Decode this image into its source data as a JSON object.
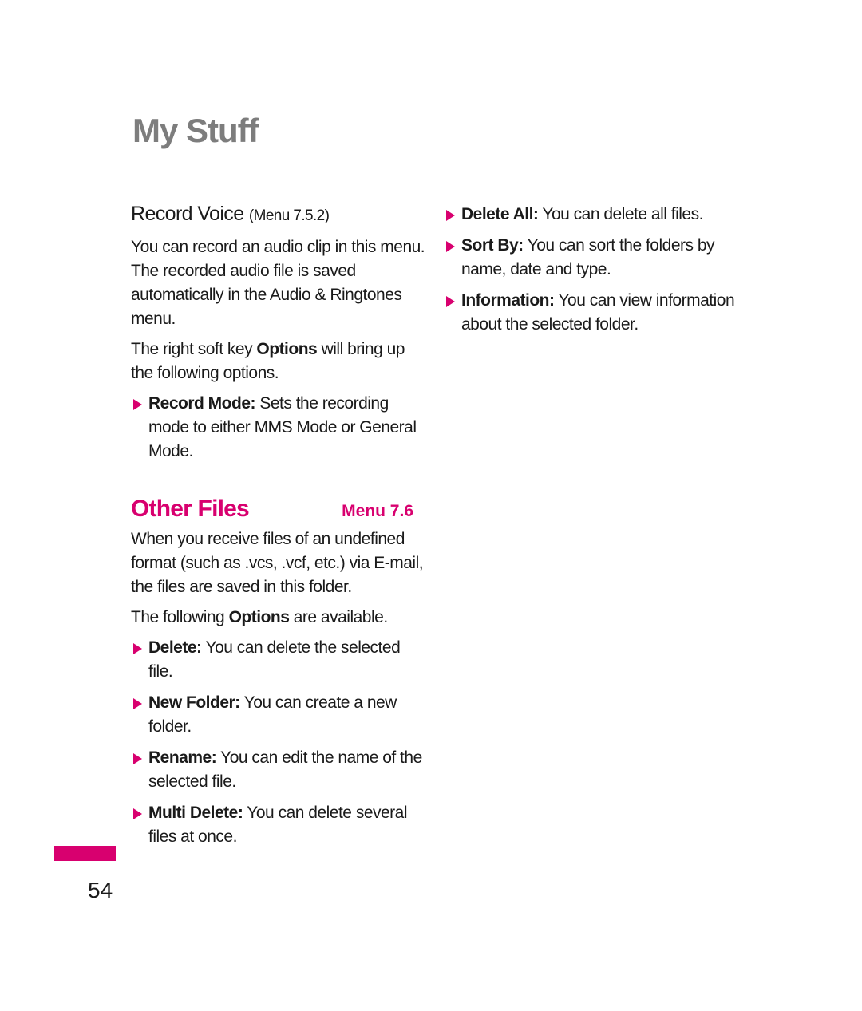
{
  "page": {
    "title": "My Stuff",
    "page_number": "54",
    "accent_color": "#d8006f"
  },
  "record_voice": {
    "heading": "Record Voice",
    "menu_ref": "(Menu 7.5.2)",
    "intro": "You can record an audio clip in this menu. The recorded audio file is saved automatically in the Audio & Ringtones menu.",
    "options_pre": "The right soft key ",
    "options_bold": "Options",
    "options_post": " will bring up the following options.",
    "bullets": [
      {
        "label": "Record Mode:",
        "text": " Sets the recording mode to either MMS Mode or General Mode."
      }
    ]
  },
  "other_files": {
    "heading": "Other Files",
    "menu_ref": "Menu 7.6",
    "intro": "When you receive files of an undefined format (such as .vcs, .vcf, etc.) via E-mail, the files are saved in this folder.",
    "options_pre": "The following ",
    "options_bold": "Options",
    "options_post": " are available.",
    "bullets": [
      {
        "label": "Delete:",
        "text": " You can delete the selected file."
      },
      {
        "label": "New Folder:",
        "text": " You can create a new folder."
      },
      {
        "label": "Rename:",
        "text": " You can edit the name of the selected file."
      },
      {
        "label": "Multi Delete:",
        "text": " You can delete several files at once."
      },
      {
        "label": "Delete All:",
        "text": " You can delete all files."
      },
      {
        "label": "Sort By:",
        "text": " You can sort the folders by name, date and type."
      },
      {
        "label": "Information:",
        "text": " You can view information about the selected folder."
      }
    ]
  }
}
